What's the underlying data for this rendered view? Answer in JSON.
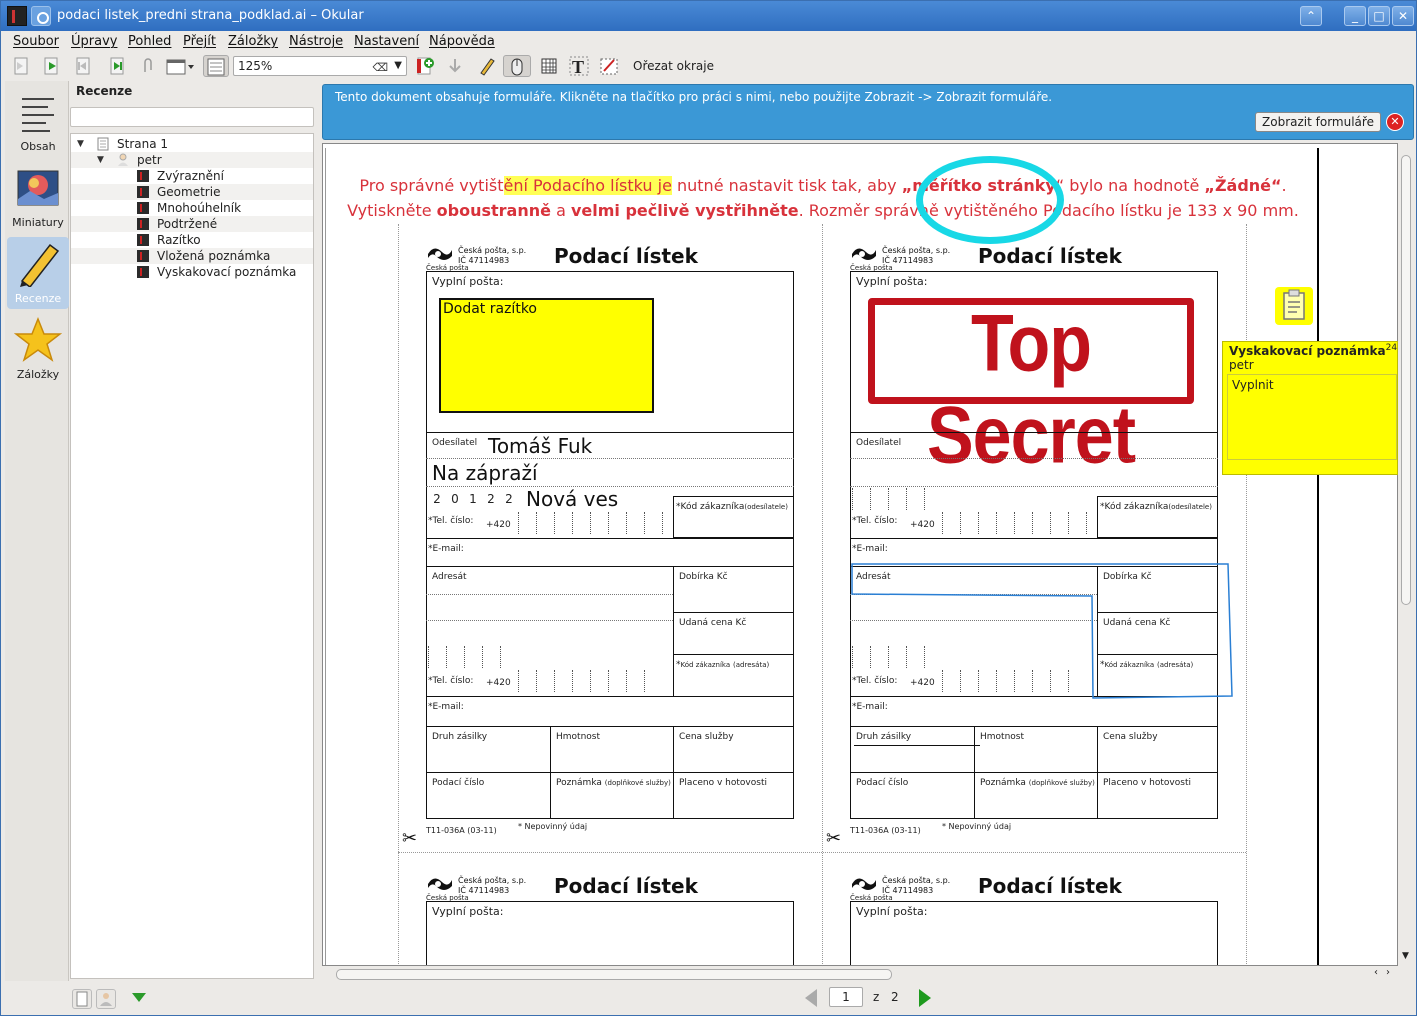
{
  "window": {
    "title": "podaci listek_predni strana_podklad.ai – Okular",
    "buttons": {
      "up": "⌃",
      "minimize": "_",
      "maximize": "□",
      "close": "✕"
    }
  },
  "menubar": [
    "Soubor",
    "Úpravy",
    "Pohled",
    "Přejít",
    "Záložky",
    "Nástroje",
    "Nastavení",
    "Nápověda"
  ],
  "toolbar": {
    "zoom": "125%",
    "crop_label": "Ořezat okraje",
    "icons": [
      "previous-page-icon",
      "next-page-icon",
      "first-page-icon",
      "last-page-icon",
      "attachment-icon",
      "view-mode-icon",
      "continuous-icon",
      "add-bookmark-icon",
      "download-icon",
      "pen-icon",
      "browse-icon",
      "table-select-icon",
      "text-select-icon",
      "review-icon"
    ]
  },
  "dock": [
    {
      "label": "Obsah",
      "icon": "contents-icon"
    },
    {
      "label": "Miniatury",
      "icon": "thumbnails-icon"
    },
    {
      "label": "Recenze",
      "icon": "pencil-icon"
    },
    {
      "label": "Záložky",
      "icon": "star-icon"
    }
  ],
  "reviews": {
    "title": "Recenze",
    "page": "Strana 1",
    "author": "petr",
    "items": [
      "Zvýraznění",
      "Geometrie",
      "Mnohoúhelník",
      "Podtržené",
      "Razítko",
      "Vložená poznámka",
      "Vyskakovací poznámka"
    ]
  },
  "infobar": {
    "text": "Tento dokument obsahuje formuláře. Klikněte na tlačítko pro práci s nimi, nebo použijte Zobrazit -> Zobrazit formuláře.",
    "button": "Zobrazit formuláře",
    "close": "✕"
  },
  "document": {
    "instr1_a": "Pro správné vytišt",
    "instr1_b": "ění Podacího lístku je",
    "instr1_c": " nutné nastavit tisk tak, aby ",
    "instr1_d": "„měřítko stránky",
    "instr1_e": "“ bylo na hodnotě ",
    "instr1_f": "„Žádné“",
    "instr1_g": ".",
    "instr2_a": "Vytiskněte ",
    "instr2_b": "oboustranně",
    "instr2_c": " a ",
    "instr2_d": "velmi pečlivě vystřihněte",
    "instr2_e": ". Rozměr správně vytištěného Podacího lístku je 133 x 90 mm.",
    "slip": {
      "title": "Podací lístek",
      "company": "Česká pošta, s.p.",
      "ico": "IČ 47114983",
      "logo_sub": "Česká pošta",
      "fill_post": "Vyplní pošta:",
      "sender": "Odesílatel",
      "tel": "Tel. číslo:",
      "prefix": "+420",
      "email": "E-mail:",
      "customer_code_sender": "Kód zákazníka",
      "customer_code_sender_small": "(odesílatele)",
      "addressee": "Adresát",
      "cod": "Dobírka Kč",
      "declared": "Udaná cena Kč",
      "customer_code_addr": "Kód zákazníka",
      "customer_code_addr_small": "(adresáta)",
      "kind": "Druh zásilky",
      "weight": "Hmotnost",
      "price": "Cena služby",
      "number": "Podací číslo",
      "note": "Poznámka",
      "note_small": "(doplňkové služby)",
      "cash": "Placeno v hotovosti",
      "form_code": "T11-036A (03-11)",
      "mandatory": "Nepovinný údaj",
      "asterisk": "*"
    },
    "filled": {
      "stamp_note": "Dodat razítko",
      "sender_name": "Tomáš Fuk",
      "street": "Na zápraží",
      "zip": [
        "2",
        "0",
        "1",
        "2",
        "2"
      ],
      "city": "Nová ves",
      "stamp": "Top Secret"
    }
  },
  "popup_note": {
    "title": "Vyskakovací poznámka",
    "sup": "24",
    "author": "petr",
    "body": "Vyplnit"
  },
  "pager": {
    "current": "1",
    "of": "z",
    "total": "2"
  },
  "colors": {
    "accent": "#3b98d6",
    "instruction": "#d8323b",
    "highlight": "#ffff55",
    "stamp": "#c0121c",
    "circle": "#18d8e6",
    "note": "#ffff00"
  }
}
